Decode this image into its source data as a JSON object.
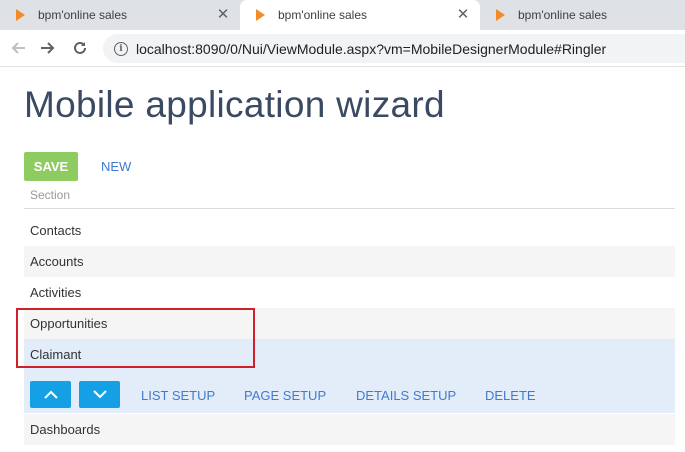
{
  "browser": {
    "tabs": [
      {
        "title": "bpm'online sales",
        "active": false
      },
      {
        "title": "bpm'online sales",
        "active": true
      },
      {
        "title": "bpm'online sales",
        "active": false
      }
    ],
    "close_glyph": "✕",
    "url": "localhost:8090/0/Nui/ViewModule.aspx?vm=MobileDesignerModule#Ringler"
  },
  "page": {
    "title": "Mobile application wizard",
    "toolbar": {
      "save_label": "SAVE",
      "new_label": "NEW"
    },
    "section_header": "Section",
    "sections": [
      {
        "label": "Contacts"
      },
      {
        "label": "Accounts"
      },
      {
        "label": "Activities"
      },
      {
        "label": "Opportunities"
      },
      {
        "label": "Claimant"
      },
      {
        "label": "Dashboards"
      }
    ],
    "selected_section": "Claimant",
    "row_actions": {
      "move_up_icon": "chevron-up-icon",
      "move_down_icon": "chevron-down-icon",
      "list_setup": "LIST SETUP",
      "page_setup": "PAGE SETUP",
      "details_setup": "DETAILS SETUP",
      "delete": "DELETE"
    }
  },
  "colors": {
    "save_button": "#8ecb60",
    "link": "#3f7bd1",
    "arrow_button": "#15a0e6",
    "selected_row": "#e3ecf9",
    "annotation_box": "#d0202a",
    "favicon": "#f28c28"
  }
}
